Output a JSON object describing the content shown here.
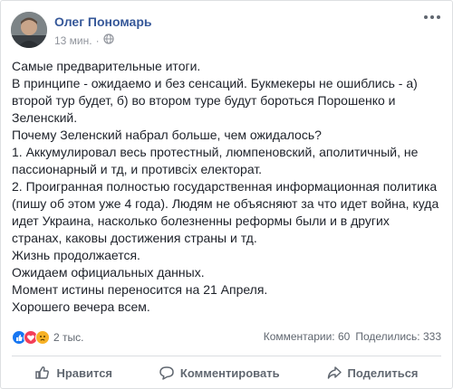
{
  "post": {
    "author": "Олег Пономарь",
    "time": "13 мин.",
    "dot": "·",
    "privacy_icon": "globe-icon",
    "lines": [
      "Самые предварительные итоги.",
      "В принципе - ожидаемо и без сенсаций. Букмекеры не ошиблись - а)",
      "второй тур будет, б) во втором туре будут бороться Порошенко и",
      "Зеленский.",
      "Почему Зеленский набрал больше, чем ожидалось?",
      "1. Аккумулировал весь протестный, люмпеновский, аполитичный, не",
      "пассионарный и тд, и противсіх електорат.",
      "2. Проигранная полностью государственная информационная политика",
      "(пишу об этом уже 4 года). Людям не объясняют за что идет война, куда",
      "идет Украина, насколько болезненны реформы были и в других",
      "странах, каковы достижения страны и тд.",
      "Жизнь продолжается.",
      "Ожидаем официальных данных.",
      "Момент истины переносится на 21 Апреля.",
      "Хорошего вечера всем."
    ]
  },
  "reactions": {
    "count": "2 тыс.",
    "icons": [
      "like-reaction-icon",
      "love-reaction-icon",
      "sad-reaction-icon"
    ],
    "colors": {
      "like": "#1877f2",
      "love": "#f33e58",
      "sad": "#f7b125"
    }
  },
  "stats": {
    "comments": "Комментарии: 60",
    "shares": "Поделились: 333"
  },
  "actions": {
    "like": "Нравится",
    "comment": "Комментировать",
    "share": "Поделиться"
  },
  "colors": {
    "author": "#365899",
    "text": "#1d2129",
    "muted": "#606770"
  }
}
